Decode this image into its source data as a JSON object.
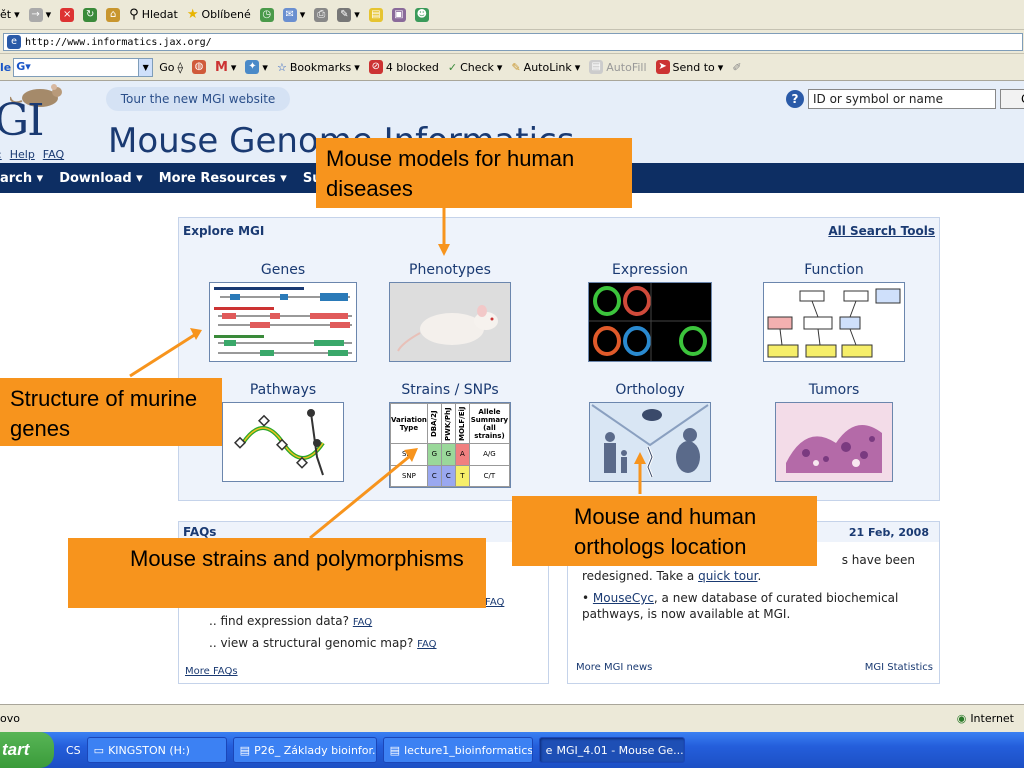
{
  "toolbar": {
    "back_label": "ět",
    "search_label": "Hledat",
    "favorites_label": "Oblíbené"
  },
  "address": {
    "url": "http://www.informatics.jax.org/"
  },
  "google_bar": {
    "go_label": "Go",
    "bookmarks_label": "Bookmarks",
    "blocked_label": "4 blocked",
    "check_label": "Check",
    "autolink_label": "AutoLink",
    "autofill_label": "AutoFill",
    "sendto_label": "Send to"
  },
  "header": {
    "tour_label": "Tour the new MGI website",
    "logo_text": "GI",
    "site_title": "Mouse Genome Informatics",
    "help_label": "Help",
    "faq_label": "FAQ",
    "search_placeholder": "ID or symbol or name"
  },
  "nav": {
    "items": [
      "arch ▾",
      "Download ▾",
      "More Resources ▾",
      "Su"
    ]
  },
  "explore": {
    "heading": "Explore MGI",
    "all_tools": "All Search Tools",
    "tiles": [
      "Genes",
      "Phenotypes",
      "Expression",
      "Function",
      "Pathways",
      "Strains / SNPs",
      "Orthology",
      "Tumors"
    ],
    "snp_table": {
      "headers": [
        "Variation Type",
        "DBA/2J",
        "PWK/PhJ",
        "MOLF/EiJ",
        "Allele Summary (all strains)"
      ],
      "rows": [
        [
          "SNP",
          "G",
          "G",
          "A",
          "A/G"
        ],
        [
          "SNP",
          "C",
          "C",
          "T",
          "C/T"
        ]
      ]
    }
  },
  "faqs": {
    "heading": "FAQs",
    "faq_link": "FAQ",
    "lines": [
      ".. find expression data?",
      ".. view a structural genomic map?"
    ],
    "more": "More FAQs"
  },
  "news": {
    "date": "21 Feb, 2008",
    "frag1": "s have been",
    "frag2_a": "redesigned. Take a ",
    "frag2_link": "quick tour",
    "frag2_b": ".",
    "bullet_link": "MouseCyc",
    "bullet_rest": ", a new database of curated biochemical",
    "bullet_rest2": "pathways, is now available at MGI.",
    "more": "More MGI news",
    "stats": "MGI Statistics"
  },
  "callouts": {
    "diseases": "Mouse models for human diseases",
    "genes": "Structure of murine genes",
    "strains": "Mouse strains  and polymorphisms",
    "orthologs": "Mouse and human orthologs location"
  },
  "status": {
    "left": "ovo",
    "zone": "Internet"
  },
  "taskbar": {
    "start": "tart",
    "lang": "CS",
    "tasks": [
      "KINGSTON (H:)",
      "P26_ Základy bioinfor...",
      "lecture1_bioinformatics",
      "MGI_4.01 - Mouse Ge..."
    ]
  },
  "colors": {
    "callout": "#f7941d",
    "nav": "#0d2e63",
    "brand": "#1a3a72"
  }
}
